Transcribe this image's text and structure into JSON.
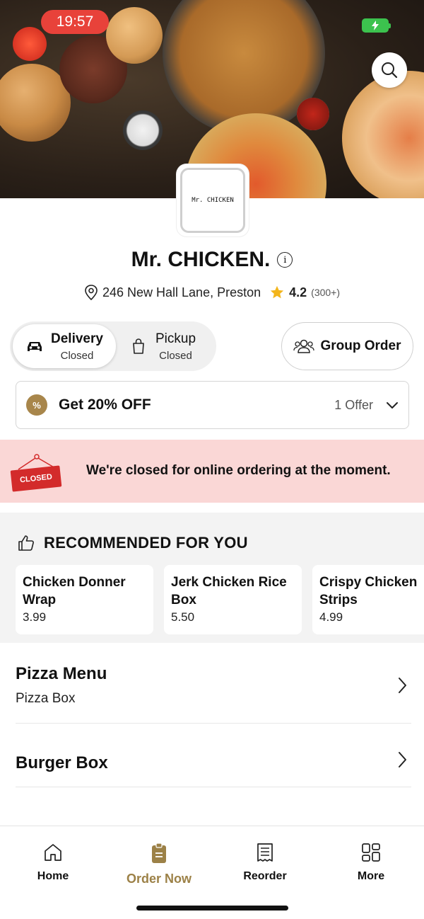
{
  "status_bar": {
    "time": "19:57"
  },
  "hero": {
    "search_icon": "search-icon"
  },
  "logo": {
    "text": "Mr. CHICKEN"
  },
  "restaurant": {
    "name": "Mr. CHICKEN.",
    "address": "246 New Hall Lane, Preston",
    "rating": "4.2",
    "rating_count": "(300+)"
  },
  "order_mode": {
    "delivery": {
      "label": "Delivery",
      "status": "Closed",
      "icon": "car-icon"
    },
    "pickup": {
      "label": "Pickup",
      "status": "Closed",
      "icon": "bag-icon"
    }
  },
  "group_order": {
    "label": "Group Order",
    "icon": "group-icon"
  },
  "offer": {
    "badge": "%",
    "title": "Get 20% OFF",
    "count": "1 Offer"
  },
  "closed_banner": {
    "sign": "CLOSED",
    "message": "We're closed for online ordering at the moment."
  },
  "recommended": {
    "title": "RECOMMENDED FOR YOU",
    "items": [
      {
        "name_line1": "Chicken Donner",
        "name_line2": "Wrap",
        "price": "3.99"
      },
      {
        "name_line1": "Jerk Chicken Rice",
        "name_line2": "Box",
        "price": "5.50"
      },
      {
        "name_line1": "Crispy Chicken",
        "name_line2": "Strips",
        "price": "4.99"
      }
    ]
  },
  "menu": [
    {
      "title": "Pizza Menu",
      "subtitle": "Pizza Box"
    },
    {
      "title": "Burger Box",
      "subtitle": ""
    }
  ],
  "bottom_nav": [
    {
      "label": "Home",
      "icon": "home-icon"
    },
    {
      "label": "Order Now",
      "icon": "order-icon",
      "active": true
    },
    {
      "label": "Reorder",
      "icon": "receipt-icon"
    },
    {
      "label": "More",
      "icon": "grid-icon"
    }
  ],
  "colors": {
    "accent": "#9c8147",
    "closed_bg": "#fad7d6",
    "status_red": "#e8423a",
    "battery_green": "#3cc24e"
  }
}
